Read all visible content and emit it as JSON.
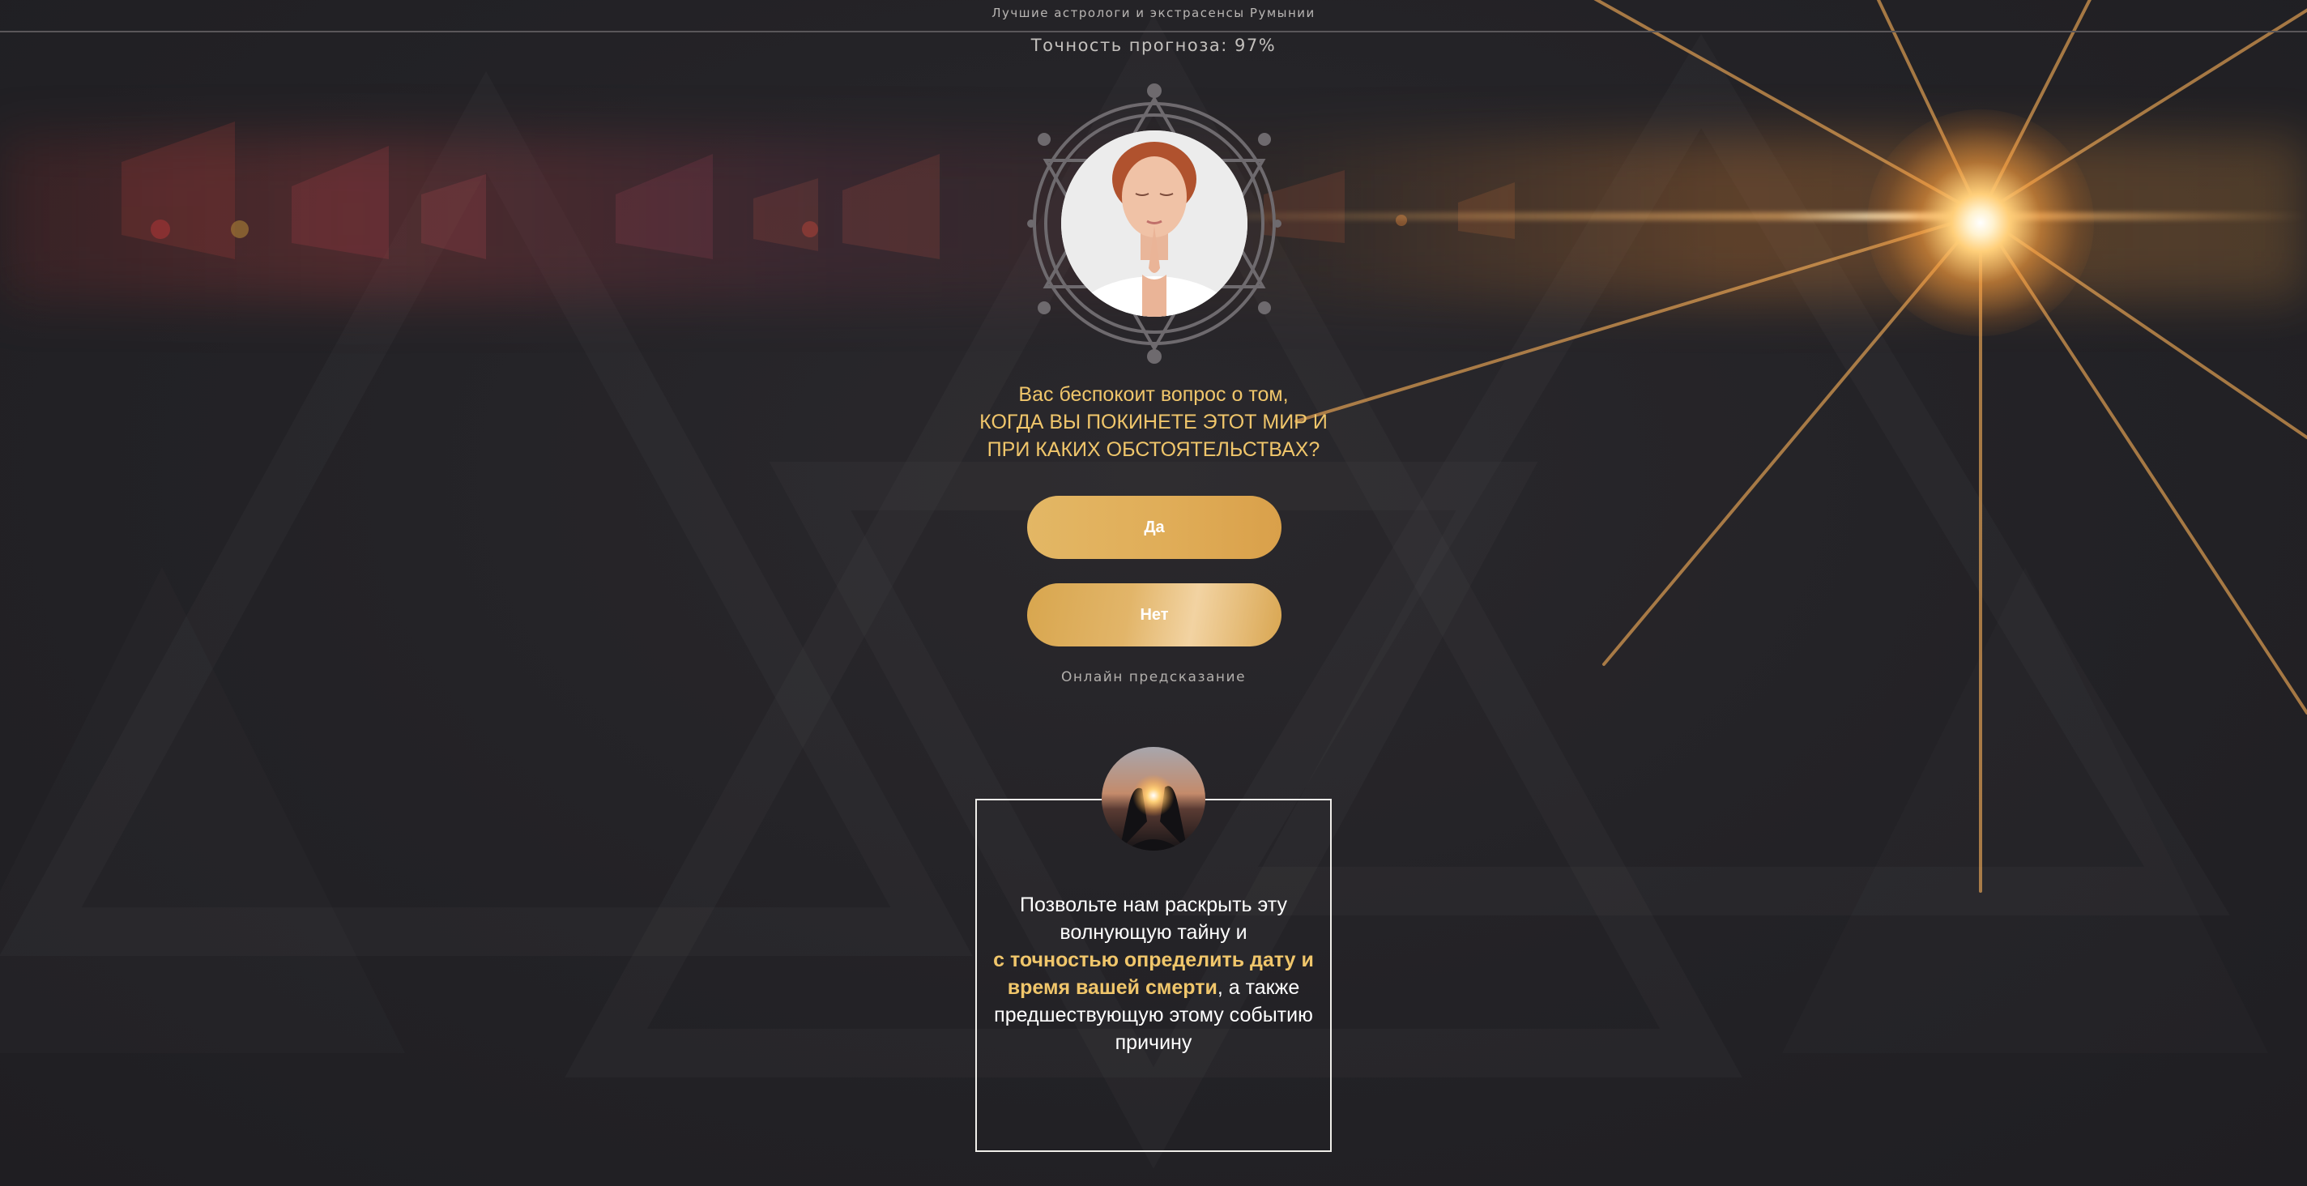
{
  "top_banner": {
    "text": "Лучшие астрологи и экстрасенсы Румынии"
  },
  "accuracy": {
    "text": "Точность прогноза: 97%"
  },
  "question": {
    "line1": "Вас беспокоит вопрос о том,",
    "line2": "КОГДА ВЫ ПОКИНЕТЕ ЭТОТ МИР И",
    "line3": "ПРИ КАКИХ ОБСТОЯТЕЛЬСТВАХ?"
  },
  "buttons": {
    "yes_label": "Да",
    "no_label": "Нет"
  },
  "online_label": "Онлайн предсказание",
  "info": {
    "text_before": "Позвольте нам раскрыть эту волнующую тайну и",
    "highlight": "с точностью определить дату и время вашей смерти",
    "text_after": ", а также предшествующую этому событию причину"
  },
  "colors": {
    "accent": "#f0c66b",
    "button_gold": "#e0ad58",
    "background": "#232226"
  }
}
